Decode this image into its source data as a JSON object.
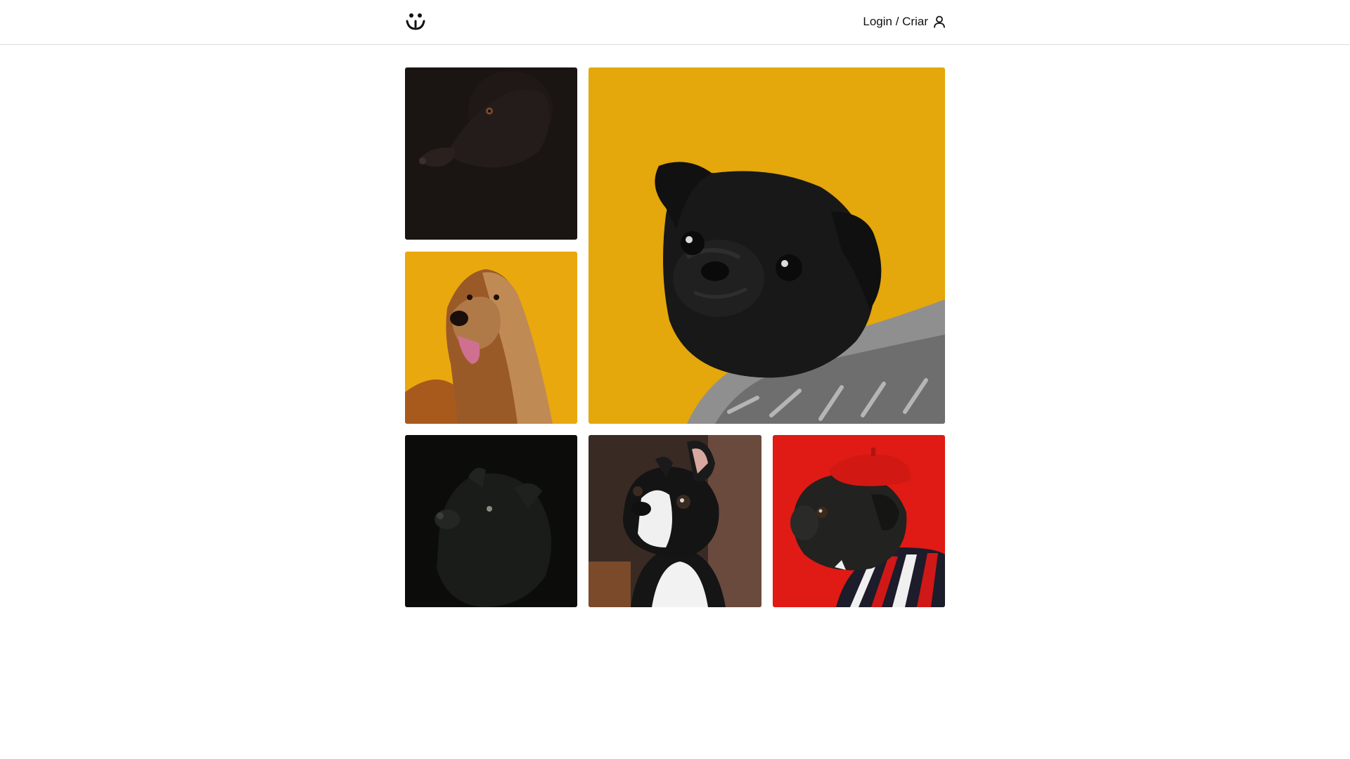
{
  "header": {
    "logo_icon": "smiley-dog-face-icon",
    "account_label": "Login / Criar",
    "account_icon": "user-icon"
  },
  "gallery": {
    "photos": [
      {
        "subject": "black-dog-dark",
        "bg": "#1a1412"
      },
      {
        "subject": "black-pug-sweater",
        "bg": "#e4a70c"
      },
      {
        "subject": "afghan-hound",
        "bg": "#eaa80f"
      },
      {
        "subject": "black-fluffy-dog",
        "bg": "#0c0d0b"
      },
      {
        "subject": "boston-terrier",
        "bg": "#3a2a24"
      },
      {
        "subject": "pug-red-beret",
        "bg": "#e01a14"
      }
    ]
  }
}
